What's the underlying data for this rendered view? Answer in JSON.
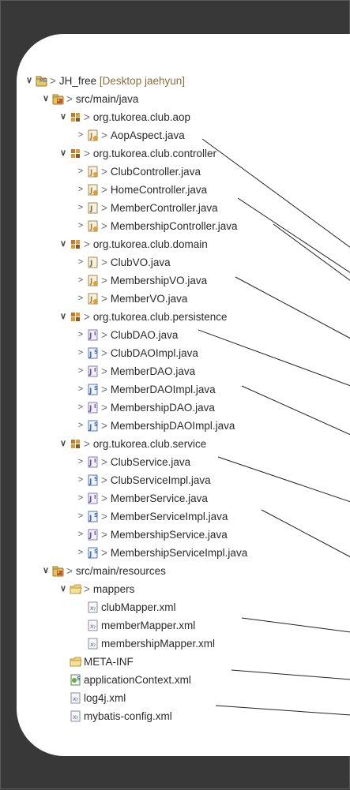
{
  "colors": {
    "background": "#383838",
    "panel": "#ffffff",
    "text": "#2a2a2a",
    "decoration": "#8a6d3b",
    "leader_line": "#222222"
  },
  "tree": [
    {
      "label": "JH_free",
      "decoration": "[Desktop jaehyun]",
      "expanded": true,
      "icon": "project-icon",
      "depth": 0
    },
    {
      "label": "src/main/java",
      "expanded": true,
      "icon": "source-folder-icon",
      "depth": 1
    },
    {
      "label": "org.tukorea.club.aop",
      "expanded": true,
      "icon": "package-icon",
      "depth": 2
    },
    {
      "label": "AopAspect.java",
      "expanded": false,
      "icon": "java-class-icon",
      "depth": 3
    },
    {
      "label": "org.tukorea.club.controller",
      "expanded": true,
      "icon": "package-icon",
      "depth": 2
    },
    {
      "label": "ClubController.java",
      "expanded": false,
      "icon": "java-class-icon",
      "depth": 3
    },
    {
      "label": "HomeController.java",
      "expanded": false,
      "icon": "java-class-icon",
      "depth": 3
    },
    {
      "label": "MemberController.java",
      "expanded": false,
      "icon": "java-file-icon",
      "depth": 3
    },
    {
      "label": "MembershipController.java",
      "expanded": false,
      "icon": "java-class-icon",
      "depth": 3
    },
    {
      "label": "org.tukorea.club.domain",
      "expanded": true,
      "icon": "package-icon",
      "depth": 2
    },
    {
      "label": "ClubVO.java",
      "expanded": false,
      "icon": "java-file-icon",
      "depth": 3
    },
    {
      "label": "MembershipVO.java",
      "expanded": false,
      "icon": "java-class-icon",
      "depth": 3
    },
    {
      "label": "MemberVO.java",
      "expanded": false,
      "icon": "java-class-icon",
      "depth": 3
    },
    {
      "label": "org.tukorea.club.persistence",
      "expanded": true,
      "icon": "package-icon",
      "depth": 2
    },
    {
      "label": "ClubDAO.java",
      "expanded": false,
      "icon": "java-interface-icon",
      "depth": 3
    },
    {
      "label": "ClubDAOImpl.java",
      "expanded": false,
      "icon": "spring-bean-icon",
      "depth": 3
    },
    {
      "label": "MemberDAO.java",
      "expanded": false,
      "icon": "java-interface-icon",
      "depth": 3
    },
    {
      "label": "MemberDAOImpl.java",
      "expanded": false,
      "icon": "spring-bean-icon",
      "depth": 3
    },
    {
      "label": "MembershipDAO.java",
      "expanded": false,
      "icon": "java-interface-icon",
      "depth": 3
    },
    {
      "label": "MembershipDAOImpl.java",
      "expanded": false,
      "icon": "spring-bean-icon",
      "depth": 3
    },
    {
      "label": "org.tukorea.club.service",
      "expanded": true,
      "icon": "package-icon",
      "depth": 2
    },
    {
      "label": "ClubService.java",
      "expanded": false,
      "icon": "java-interface-icon",
      "depth": 3
    },
    {
      "label": "ClubServiceImpl.java",
      "expanded": false,
      "icon": "spring-bean-icon",
      "depth": 3
    },
    {
      "label": "MemberService.java",
      "expanded": false,
      "icon": "java-interface-icon",
      "depth": 3
    },
    {
      "label": "MemberServiceImpl.java",
      "expanded": false,
      "icon": "spring-bean-icon",
      "depth": 3
    },
    {
      "label": "MembershipService.java",
      "expanded": false,
      "icon": "java-interface-icon",
      "depth": 3
    },
    {
      "label": "MembershipServiceImpl.java",
      "expanded": false,
      "icon": "spring-bean-icon",
      "depth": 3
    },
    {
      "label": "src/main/resources",
      "expanded": true,
      "icon": "source-folder-icon",
      "depth": 1
    },
    {
      "label": "mappers",
      "expanded": true,
      "icon": "folder-icon",
      "depth": 2
    },
    {
      "label": "clubMapper.xml",
      "icon": "xml-file-icon",
      "depth": 3,
      "leaf": true
    },
    {
      "label": "memberMapper.xml",
      "icon": "xml-file-icon",
      "depth": 3,
      "leaf": true
    },
    {
      "label": "membershipMapper.xml",
      "icon": "xml-file-icon",
      "depth": 3,
      "leaf": true
    },
    {
      "label": "META-INF",
      "icon": "folder-icon",
      "depth": 2,
      "leaf": true
    },
    {
      "label": "applicationContext.xml",
      "icon": "spring-config-icon",
      "depth": 2,
      "leaf": true
    },
    {
      "label": "log4j.xml",
      "icon": "xml-file-icon",
      "depth": 2,
      "leaf": true
    },
    {
      "label": "mybatis-config.xml",
      "icon": "xml-file-icon",
      "depth": 2,
      "leaf": true
    }
  ]
}
